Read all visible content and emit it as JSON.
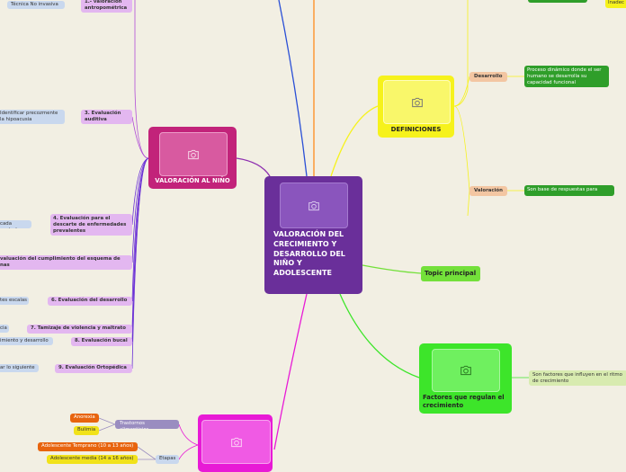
{
  "central": {
    "title": "VALORACIÓN DEL CRECIMIENTO Y DESARROLLO DEL NIÑO Y ADOLESCENTE",
    "icon": "camera-icon",
    "color": "#6a2f9a"
  },
  "topic_principal": {
    "label": "Topic principal",
    "color": "#73e03a"
  },
  "definiciones": {
    "title": "DEFINICIONES",
    "icon": "camera-icon",
    "color": "#f6f21c",
    "items": [
      {
        "label": "Desarrollo",
        "detail": "Proceso dinámico donde el ser humano se desarrolla su capacidad funcional"
      },
      {
        "label": "Valoración",
        "detail": "Son base de respuestas para"
      }
    ],
    "partial_right": "Inadec"
  },
  "factores": {
    "title": "Factores que regulan el crecimiento",
    "icon": "camera-icon",
    "color": "#3de52a",
    "detail": "Son factores que influyen en el ritmo de crecimiento"
  },
  "valoracion_nino": {
    "title": "VALORACIÓN AL NIÑO",
    "icon": "camera-icon",
    "color": "#c2237a",
    "items": [
      {
        "label": "1.- valoración antropométrica",
        "detail": "Técnica No invasiva"
      },
      {
        "label": "3. Evaluación auditiva",
        "detail": "Identificar precozmente la hipoacusia"
      },
      {
        "label": "4. Evaluación para el descarte de enfermedades prevalentes",
        "detail": "cada control"
      },
      {
        "label": "valuación del cumplimiento del esquema de nas",
        "detail": ""
      },
      {
        "label": "6. Evaluación del desarrollo",
        "detail": "tes escalas"
      },
      {
        "label": "7. Tamizaje de violencia y maltrato",
        "detail": "cia"
      },
      {
        "label": "8. Evaluación bucal",
        "detail": "imiento y desarrollo"
      },
      {
        "label": "9. Evaluación Ortopédica",
        "detail": "ar lo siguiente"
      }
    ]
  },
  "adolescente": {
    "title": "",
    "icon": "camera-icon",
    "color": "#e81ad6",
    "trastornos": {
      "label": "Trastornos alimenticios",
      "items": [
        "Anorexia",
        "Bulimia"
      ]
    },
    "etapas": {
      "label": "Etapas",
      "items": [
        "Adolescente Temprano (10 a 13 años)",
        "Adolescente media (14 a 16 años)"
      ]
    }
  }
}
